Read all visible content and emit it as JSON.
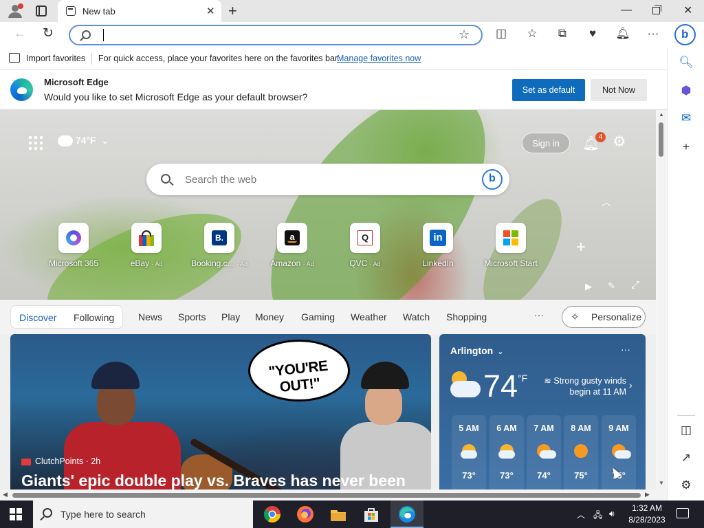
{
  "browser": {
    "tab_title": "New tab",
    "address_value": "",
    "favorites_bar": {
      "import_label": "Import favorites",
      "hint": "For quick access, place your favorites here on the favorites bar.",
      "manage_link": "Manage favorites now"
    },
    "banner": {
      "title": "Microsoft Edge",
      "message": "Would you like to set Microsoft Edge as your default browser?",
      "set_default": "Set as default",
      "not_now": "Not Now"
    }
  },
  "ntp": {
    "weather_mini": "74°F",
    "signin": "Sign in",
    "notification_count": "4",
    "search_placeholder": "Search the web",
    "tiles": [
      {
        "label": "Microsoft 365",
        "ad": ""
      },
      {
        "label": "eBay",
        "ad": "· Ad"
      },
      {
        "label": "Booking.c...",
        "ad": "· Ad"
      },
      {
        "label": "Amazon",
        "ad": "· Ad"
      },
      {
        "label": "QVC",
        "ad": "· Ad"
      },
      {
        "label": "LinkedIn",
        "ad": ""
      },
      {
        "label": "Microsoft Start",
        "ad": ""
      }
    ],
    "feed_tabs": {
      "discover": "Discover",
      "following": "Following",
      "items": [
        "News",
        "Sports",
        "Play",
        "Money",
        "Gaming",
        "Weather",
        "Watch",
        "Shopping"
      ],
      "more": "···",
      "personalize": "Personalize"
    },
    "article": {
      "bubble": "\"YOU'RE OUT!\"",
      "source": "ClutchPoints · 2h",
      "title": "Giants' epic double play vs. Braves has never been"
    },
    "weather": {
      "location": "Arlington",
      "temp": "74",
      "unit": "°F",
      "alert_line1": "Strong gusty winds",
      "alert_line2": "begin at 11 AM",
      "hours": [
        {
          "time": "5 AM",
          "temp": "73°",
          "icon": "moon-cloud-icon"
        },
        {
          "time": "6 AM",
          "temp": "73°",
          "icon": "moon-cloud-icon"
        },
        {
          "time": "7 AM",
          "temp": "74°",
          "icon": "sun-cloud-icon"
        },
        {
          "time": "8 AM",
          "temp": "75°",
          "icon": "sun-icon"
        },
        {
          "time": "9 AM",
          "temp": "75°",
          "icon": "sun-cloud-icon"
        }
      ]
    }
  },
  "taskbar": {
    "search_placeholder": "Type here to search",
    "time": "1:32 AM",
    "date": "8/28/2023"
  },
  "colors": {
    "accent": "#0f6cbd",
    "link": "#1a5fb4",
    "taskbar": "#1f1f2a"
  }
}
